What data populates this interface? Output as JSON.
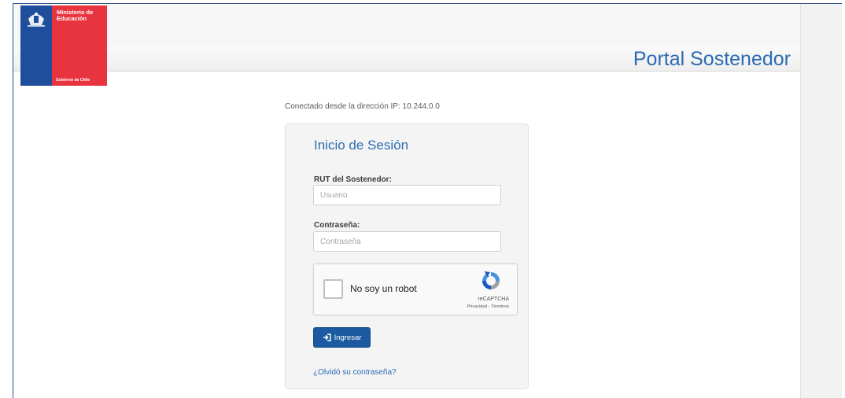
{
  "header": {
    "logo": {
      "ministry_line1": "Ministerio de",
      "ministry_line2": "Educación",
      "government": "Gobierno de Chile",
      "colors": {
        "blue": "#1f4f9c",
        "red": "#e8343f"
      }
    },
    "portal_title": "Portal Sostenedor"
  },
  "main": {
    "ip_notice": "Conectado desde la dirección IP: 10.244.0.0",
    "login": {
      "title": "Inicio de Sesión",
      "rut_label": "RUT del Sostenedor:",
      "rut_placeholder": "Usuario",
      "password_label": "Contraseña:",
      "password_placeholder": "Contraseña",
      "captcha": {
        "checkbox_label": "No soy un robot",
        "brand": "reCAPTCHA",
        "links": "Privacidad - Términos",
        "icon": "recaptcha-icon"
      },
      "submit_label": "Ingresar",
      "submit_icon": "sign-in-icon",
      "forgot_link": "¿Olvidó su contraseña?"
    }
  },
  "colors": {
    "accent": "#2c6db3",
    "button": "#1b5aa0",
    "frame": "#2b4f86"
  }
}
